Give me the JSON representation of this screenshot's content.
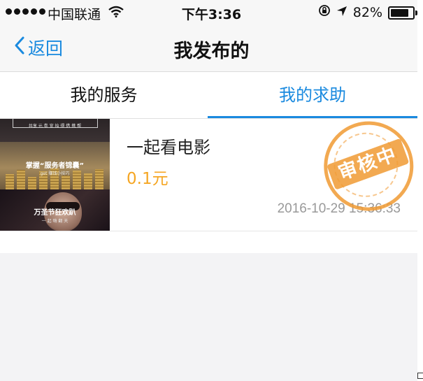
{
  "status_bar": {
    "carrier": "中国联通",
    "time": "下午3:36",
    "battery_percent": "82%",
    "battery_level": 0.82,
    "signal_dots": 5,
    "icons": [
      "wifi-icon",
      "rotation-lock-icon",
      "location-arrow-icon",
      "battery-icon"
    ]
  },
  "nav": {
    "back_label": "返回",
    "title": "我发布的"
  },
  "tabs": [
    {
      "label": "我的服务",
      "active": false
    },
    {
      "label": "我的求助",
      "active": true
    }
  ],
  "items": [
    {
      "title": "一起看电影",
      "price": "0.1元",
      "time": "2016-10-29 15:36:33",
      "stamp": "审核中",
      "thumbnail_lines": {
        "top": "共享 元 卷 宣 抬 得 借 携 帮",
        "middle": "掌握“服务者锦囊”",
        "middle_sub": "get 赚钱小技巧",
        "bottom": "万圣节狂欢趴",
        "bottom_sub": "一 起 嗨 翻 天"
      }
    }
  ],
  "colors": {
    "accent": "#1a8adf",
    "price": "#f5a623",
    "stamp": "#f09a32",
    "background": "#f3f3f5"
  }
}
